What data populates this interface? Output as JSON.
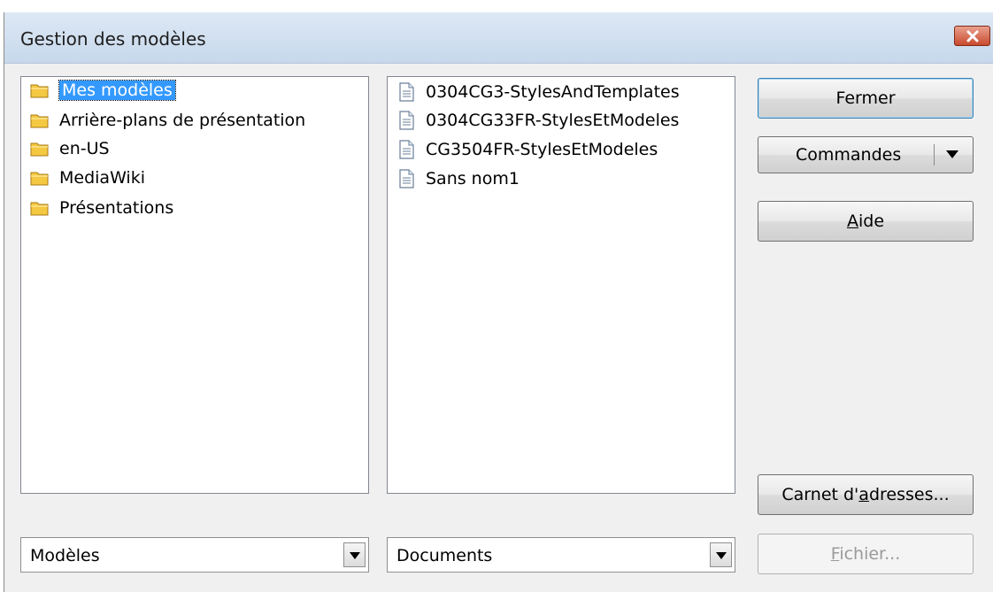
{
  "dialog": {
    "title": "Gestion des modèles"
  },
  "left_list": {
    "items": [
      {
        "label": "Mes modèles",
        "icon": "folder-icon",
        "selected": true
      },
      {
        "label": "Arrière-plans de présentation",
        "icon": "folder-icon"
      },
      {
        "label": "en-US",
        "icon": "folder-icon"
      },
      {
        "label": "MediaWiki",
        "icon": "folder-icon"
      },
      {
        "label": "Présentations",
        "icon": "folder-icon"
      }
    ]
  },
  "right_list": {
    "items": [
      {
        "label": "0304CG3-StylesAndTemplates",
        "icon": "document-icon"
      },
      {
        "label": "0304CG33FR-StylesEtModeles",
        "icon": "document-icon"
      },
      {
        "label": "CG3504FR-StylesEtModeles",
        "icon": "document-icon"
      },
      {
        "label": "Sans nom1",
        "icon": "document-icon"
      }
    ]
  },
  "buttons": {
    "close": "Fermer",
    "commands": "Commandes",
    "help_mnemonic": "A",
    "help_rest": "ide",
    "address_book_pre": "Carnet d'",
    "address_book_mnemonic": "a",
    "address_book_post": "dresses...",
    "file_mnemonic": "F",
    "file_rest": "ichier..."
  },
  "left_combo": {
    "value": "Modèles"
  },
  "right_combo": {
    "value": "Documents"
  },
  "colors": {
    "selection": "#3399ff",
    "close_button": "#c94a2e",
    "folder": "#f5c842"
  }
}
